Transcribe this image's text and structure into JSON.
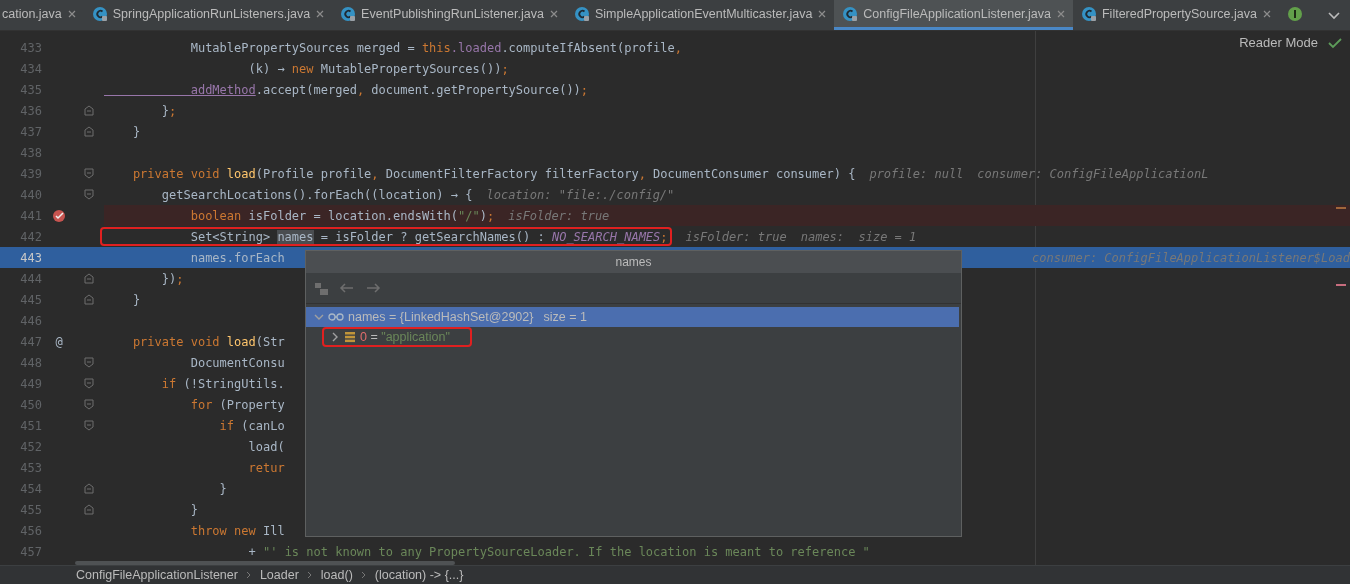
{
  "tabs": [
    {
      "kind": "plain",
      "label": "cation.java",
      "selected": false
    },
    {
      "kind": "class",
      "label": "SpringApplicationRunListeners.java",
      "selected": false
    },
    {
      "kind": "class",
      "label": "EventPublishingRunListener.java",
      "selected": false
    },
    {
      "kind": "class",
      "label": "SimpleApplicationEventMulticaster.java",
      "selected": false
    },
    {
      "kind": "class",
      "label": "ConfigFileApplicationListener.java",
      "selected": true
    },
    {
      "kind": "class",
      "label": "FilteredPropertySource.java",
      "selected": false
    },
    {
      "kind": "interface",
      "selected": false
    }
  ],
  "reader_mode": {
    "label": "Reader Mode"
  },
  "editor": {
    "lines": [
      {
        "number": "433",
        "tokens": [
          {
            "kind": "plain",
            "text": "            MutablePropertySources merged = "
          },
          {
            "kind": "keyword",
            "text": "this"
          },
          {
            "kind": "field",
            "text": ".loaded"
          },
          {
            "kind": "plain",
            "text": ".computeIfAbsent(profile"
          },
          {
            "kind": "keyword",
            "text": ","
          }
        ]
      },
      {
        "number": "434",
        "tokens": [
          {
            "kind": "plain",
            "text": "                    (k) → "
          },
          {
            "kind": "keyword",
            "text": "new"
          },
          {
            "kind": "plain",
            "text": " MutablePropertySources())"
          },
          {
            "kind": "keyword",
            "text": ";"
          }
        ]
      },
      {
        "number": "435",
        "tokens": [
          {
            "kind": "link",
            "text": "            addMethod"
          },
          {
            "kind": "plain",
            "text": ".accept(merged"
          },
          {
            "kind": "keyword",
            "text": ","
          },
          {
            "kind": "plain",
            "text": " document.getPropertySource())"
          },
          {
            "kind": "keyword",
            "text": ";"
          }
        ]
      },
      {
        "number": "436",
        "fold_end": true,
        "tokens": [
          {
            "kind": "plain",
            "text": "        }"
          },
          {
            "kind": "keyword",
            "text": ";"
          }
        ]
      },
      {
        "number": "437",
        "fold_end": true,
        "tokens": [
          {
            "kind": "plain",
            "text": "    }"
          }
        ]
      },
      {
        "number": "438"
      },
      {
        "number": "439",
        "fold_start": true,
        "tokens": [
          {
            "kind": "keyword",
            "text": "    private void "
          },
          {
            "kind": "method",
            "text": "load"
          },
          {
            "kind": "plain",
            "text": "(Profile profile"
          },
          {
            "kind": "keyword",
            "text": ","
          },
          {
            "kind": "plain",
            "text": " DocumentFilterFactory filterFactory"
          },
          {
            "kind": "keyword",
            "text": ","
          },
          {
            "kind": "plain",
            "text": " DocumentConsumer consumer) {"
          },
          {
            "kind": "hint",
            "text": "profile: null"
          },
          {
            "kind": "hint",
            "text": "consumer: ConfigFileApplicationL"
          }
        ]
      },
      {
        "number": "440",
        "fold_start": true,
        "tokens": [
          {
            "kind": "plain",
            "text": "        getSearchLocations().forEach((location) → {"
          },
          {
            "kind": "hint",
            "text": "location: \"file:./config/\""
          }
        ]
      },
      {
        "number": "441",
        "breakpoint": true,
        "tokens": [
          {
            "kind": "keyword",
            "text": "            boolean"
          },
          {
            "kind": "plain",
            "text": " isFolder = location.endsWith("
          },
          {
            "kind": "string",
            "text": "\"/\""
          },
          {
            "kind": "plain",
            "text": ")"
          },
          {
            "kind": "keyword",
            "text": ";"
          },
          {
            "kind": "hint",
            "text": "isFolder: true"
          }
        ]
      },
      {
        "number": "442",
        "highlighted": true,
        "tokens": [
          {
            "kind": "plain",
            "text": "            Set<String> "
          },
          {
            "kind": "usage",
            "text": "names"
          },
          {
            "kind": "plain",
            "text": " = isFolder ? getSearchNames() : "
          },
          {
            "kind": "constant",
            "text": "NO_SEARCH_NAMES"
          },
          {
            "kind": "keyword",
            "text": ";"
          },
          {
            "kind": "hint",
            "text": "isFolder: true"
          },
          {
            "kind": "hint",
            "text": "names:  size = 1"
          }
        ]
      },
      {
        "number": "443",
        "current": true,
        "tokens": [
          {
            "kind": "plain",
            "text": "            names.forEach"
          },
          {
            "kind": "far-hint",
            "text": "consumer: ConfigFileApplicationListener$Load"
          }
        ]
      },
      {
        "number": "444",
        "fold_end": true,
        "tokens": [
          {
            "kind": "plain",
            "text": "        })"
          },
          {
            "kind": "keyword",
            "text": ";"
          }
        ]
      },
      {
        "number": "445",
        "fold_end": true,
        "tokens": [
          {
            "kind": "plain",
            "text": "    }"
          }
        ]
      },
      {
        "number": "446"
      },
      {
        "number": "447",
        "gutter_text": "@",
        "tokens": [
          {
            "kind": "keyword",
            "text": "    private void "
          },
          {
            "kind": "method",
            "text": "load"
          },
          {
            "kind": "plain",
            "text": "(Str"
          }
        ]
      },
      {
        "number": "448",
        "fold_start": true,
        "tokens": [
          {
            "kind": "plain",
            "text": "            DocumentConsu"
          }
        ]
      },
      {
        "number": "449",
        "fold_start": true,
        "tokens": [
          {
            "kind": "keyword",
            "text": "        if"
          },
          {
            "kind": "plain",
            "text": " (!StringUtils."
          }
        ]
      },
      {
        "number": "450",
        "fold_start": true,
        "tokens": [
          {
            "kind": "keyword",
            "text": "            for"
          },
          {
            "kind": "plain",
            "text": " (Property"
          }
        ]
      },
      {
        "number": "451",
        "fold_start": true,
        "tokens": [
          {
            "kind": "keyword",
            "text": "                if"
          },
          {
            "kind": "plain",
            "text": " (canLo"
          }
        ]
      },
      {
        "number": "452",
        "tokens": [
          {
            "kind": "plain",
            "text": "                    load("
          }
        ]
      },
      {
        "number": "453",
        "tokens": [
          {
            "kind": "keyword",
            "text": "                    retur"
          }
        ]
      },
      {
        "number": "454",
        "fold_end": true,
        "tokens": [
          {
            "kind": "plain",
            "text": "                }"
          }
        ]
      },
      {
        "number": "455",
        "fold_end": true,
        "tokens": [
          {
            "kind": "plain",
            "text": "            }"
          }
        ]
      },
      {
        "number": "456",
        "tokens": [
          {
            "kind": "keyword",
            "text": "            throw new"
          },
          {
            "kind": "plain",
            "text": " Ill"
          }
        ]
      },
      {
        "number": "457",
        "tokens": [
          {
            "kind": "plain",
            "text": "                    + "
          },
          {
            "kind": "string",
            "text": "\"' is not known to any PropertySourceLoader. If the location is meant to reference \""
          }
        ]
      }
    ]
  },
  "popup": {
    "title": "names",
    "nodes": [
      {
        "name": "names",
        "op": "=",
        "value": "{LinkedHashSet@2902}",
        "extra": "size = 1",
        "expanded": true,
        "selected": true,
        "children": [
          {
            "name": "0",
            "op": "=",
            "value": "\"application\"",
            "expanded": false,
            "selected": false,
            "highlighted": true
          }
        ]
      }
    ]
  },
  "breadcrumbs": [
    "ConfigFileApplicationListener",
    "Loader",
    "load()",
    "(location) -> {...}"
  ]
}
